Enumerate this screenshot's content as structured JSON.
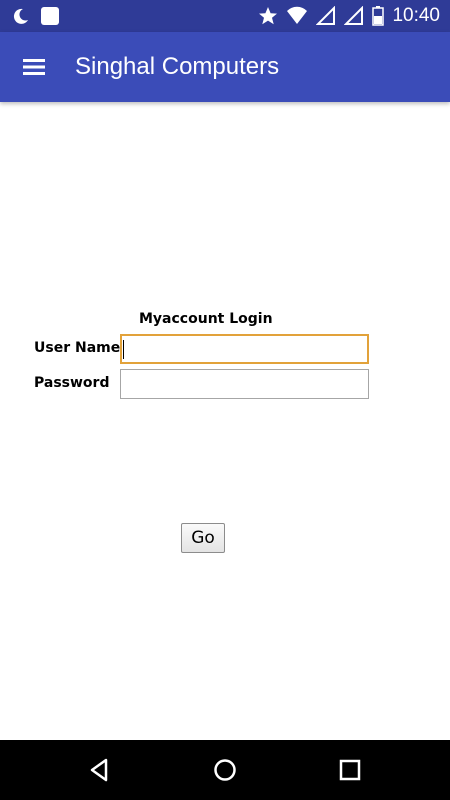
{
  "status_bar": {
    "time": "10:40",
    "left_icons": [
      "moon-icon",
      "app-notification-icon"
    ],
    "right_icons": [
      "star-icon",
      "wifi-icon",
      "signal-icon",
      "battery-icon"
    ]
  },
  "app_bar": {
    "title": "Singhal Computers",
    "menu_icon": "hamburger-menu-icon",
    "color": "#3b4cb8"
  },
  "login": {
    "title": "Myaccount Login",
    "username_label": "User Name",
    "username_value": "",
    "password_label": "Password",
    "password_value": "",
    "submit_label": "Go",
    "focus_color": "#e2a23a"
  },
  "nav_bar": {
    "icons": [
      "back-icon",
      "home-icon",
      "recents-icon"
    ]
  }
}
